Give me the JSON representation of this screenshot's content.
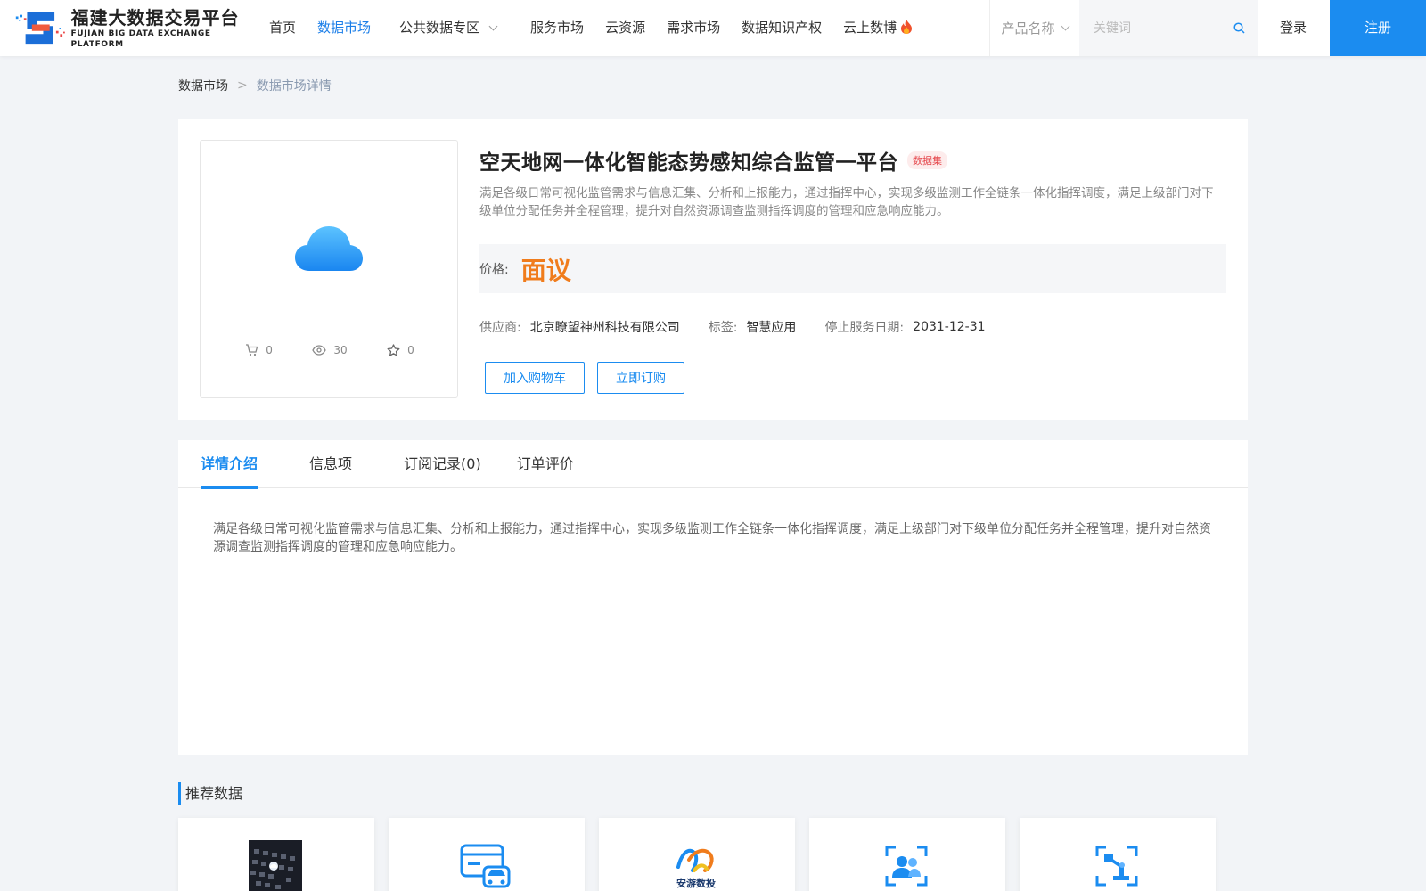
{
  "header": {
    "logo_cn": "福建大数据交易平台",
    "logo_en": "FUJIAN BIG DATA EXCHANGE  PLATFORM",
    "nav": [
      {
        "label": "首页",
        "active": false
      },
      {
        "label": "数据市场",
        "active": true
      },
      {
        "label": "公共数据专区",
        "active": false
      },
      {
        "label": "服务市场",
        "active": false
      },
      {
        "label": "云资源",
        "active": false
      },
      {
        "label": "需求市场",
        "active": false
      },
      {
        "label": "数据知识产权",
        "active": false
      },
      {
        "label": "云上数博",
        "active": false
      }
    ],
    "search_type": "产品名称",
    "search_placeholder": "关键词",
    "login": "登录",
    "register": "注册",
    "accent": "#1b8cf0"
  },
  "breadcrumb": {
    "root": "数据市场",
    "separator": ">",
    "current": "数据市场详情"
  },
  "product": {
    "title": "空天地网一体化智能态势感知综合监管一平台",
    "badge": "数据集",
    "description": "满足各级日常可视化监管需求与信息汇集、分析和上报能力，通过指挥中心，实现多级监测工作全链条一体化指挥调度，满足上级部门对下级单位分配任务并全程管理，提升对自然资源调查监测指挥调度的管理和应急响应能力。",
    "price_label": "价格:",
    "price_value": "面议",
    "stats": {
      "cart": "0",
      "views": "30",
      "favorites": "0"
    },
    "supplier_label": "供应商:",
    "supplier": "北京瞭望神州科技有限公司",
    "tag_label": "标签:",
    "tag": "智慧应用",
    "end_label": "停止服务日期:",
    "end_date": "2031-12-31",
    "add_cart": "加入购物车",
    "subscribe": "立即订购",
    "price_color": "#f07c1c"
  },
  "detail": {
    "tabs": [
      {
        "label": "详情介绍",
        "active": true
      },
      {
        "label": "信息项",
        "active": false
      },
      {
        "label": "订阅记录(0)",
        "active": false
      },
      {
        "label": "订单评价",
        "active": false
      }
    ],
    "text": "满足各级日常可视化监管需求与信息汇集、分析和上报能力，通过指挥中心，实现多级监测工作全链条一体化指挥调度，满足上级部门对下级单位分配任务并全程管理，提升对自然资源调查监测指挥调度的管理和应急响应能力。"
  },
  "recommended": {
    "title": "推荐数据",
    "cards": [
      {
        "icon": "keyboard-photo-icon"
      },
      {
        "icon": "car-card-icon"
      },
      {
        "icon": "brand-logo-icon",
        "logo_text": "安游数投"
      },
      {
        "icon": "user-scan-icon"
      },
      {
        "icon": "robot-arm-icon"
      }
    ]
  }
}
